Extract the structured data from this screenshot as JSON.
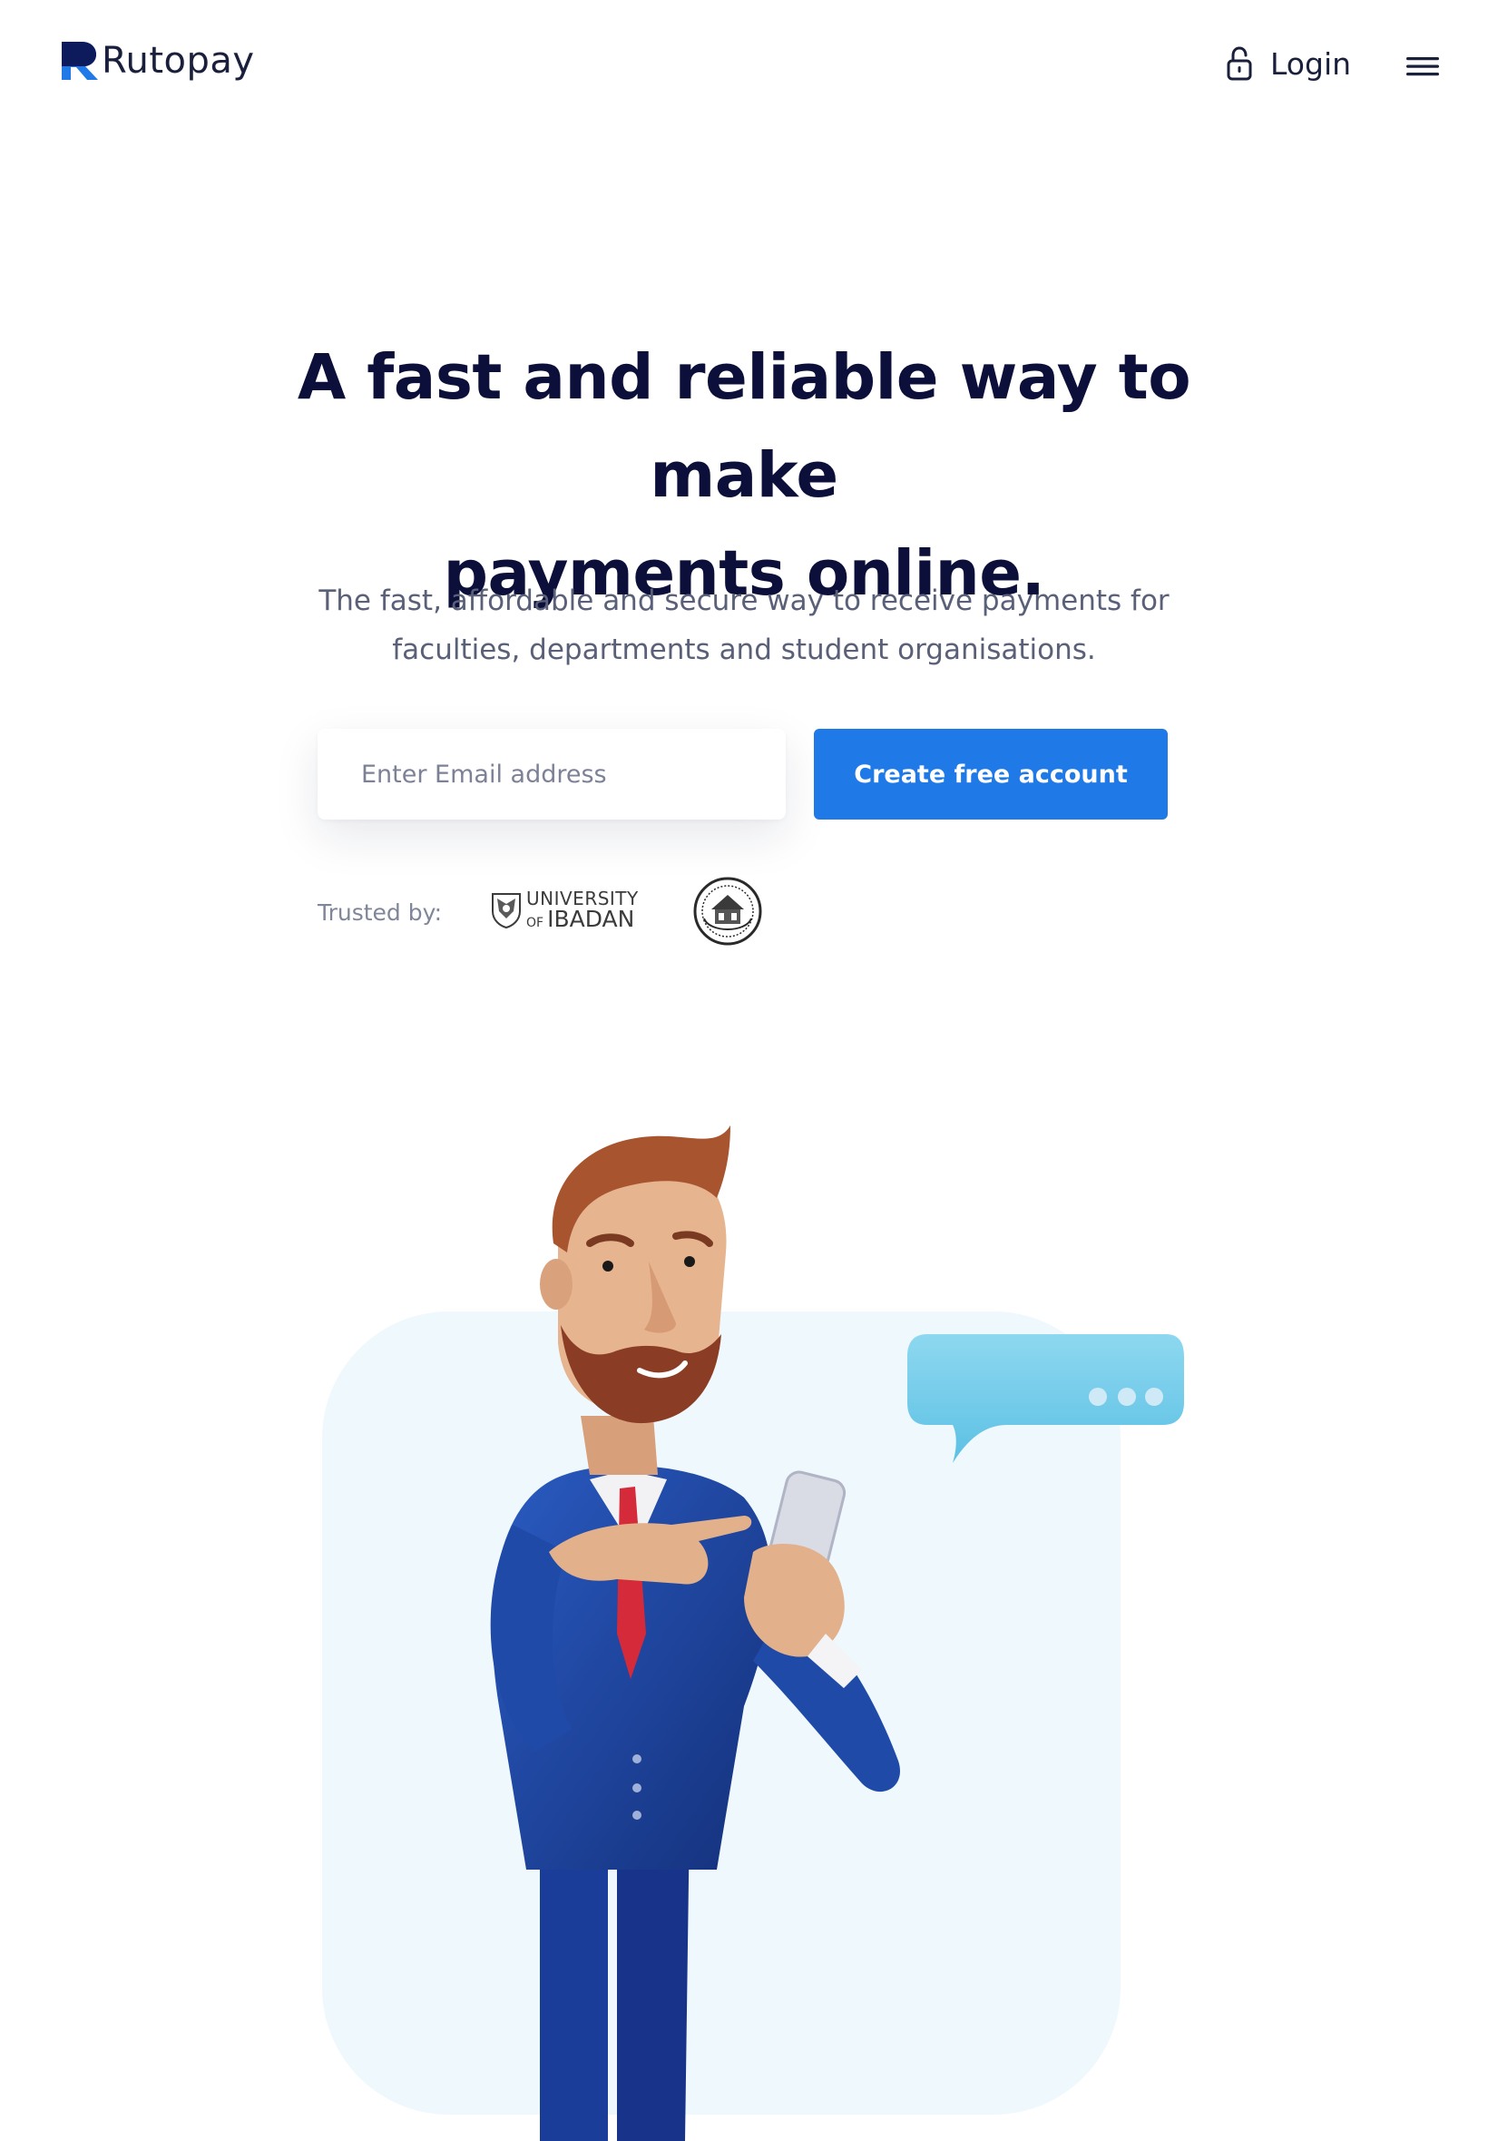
{
  "brand": {
    "name": "Rutopay",
    "accent": "#1f7ae8"
  },
  "nav": {
    "login_label": "Login",
    "login_icon": "lock-icon",
    "menu_icon": "hamburger-menu-icon"
  },
  "hero": {
    "title_line1": "A fast and reliable way to make",
    "title_line2": "payments online.",
    "subtitle_line1": "The fast, affordable and secure way to receive payments for",
    "subtitle_line2": "faculties, departments and student organisations."
  },
  "signup": {
    "email_placeholder": "Enter Email address",
    "cta_label": "Create free account"
  },
  "trusted": {
    "label": "Trusted by:",
    "logos": [
      {
        "line1": "UNIVERSITY",
        "of": "OF",
        "line2": "IBADAN"
      },
      {
        "icon": "institution-seal-icon"
      }
    ]
  },
  "illustration": {
    "icon": "businessman-with-phone-illustration",
    "bubble_icon": "chat-bubble-icon"
  }
}
